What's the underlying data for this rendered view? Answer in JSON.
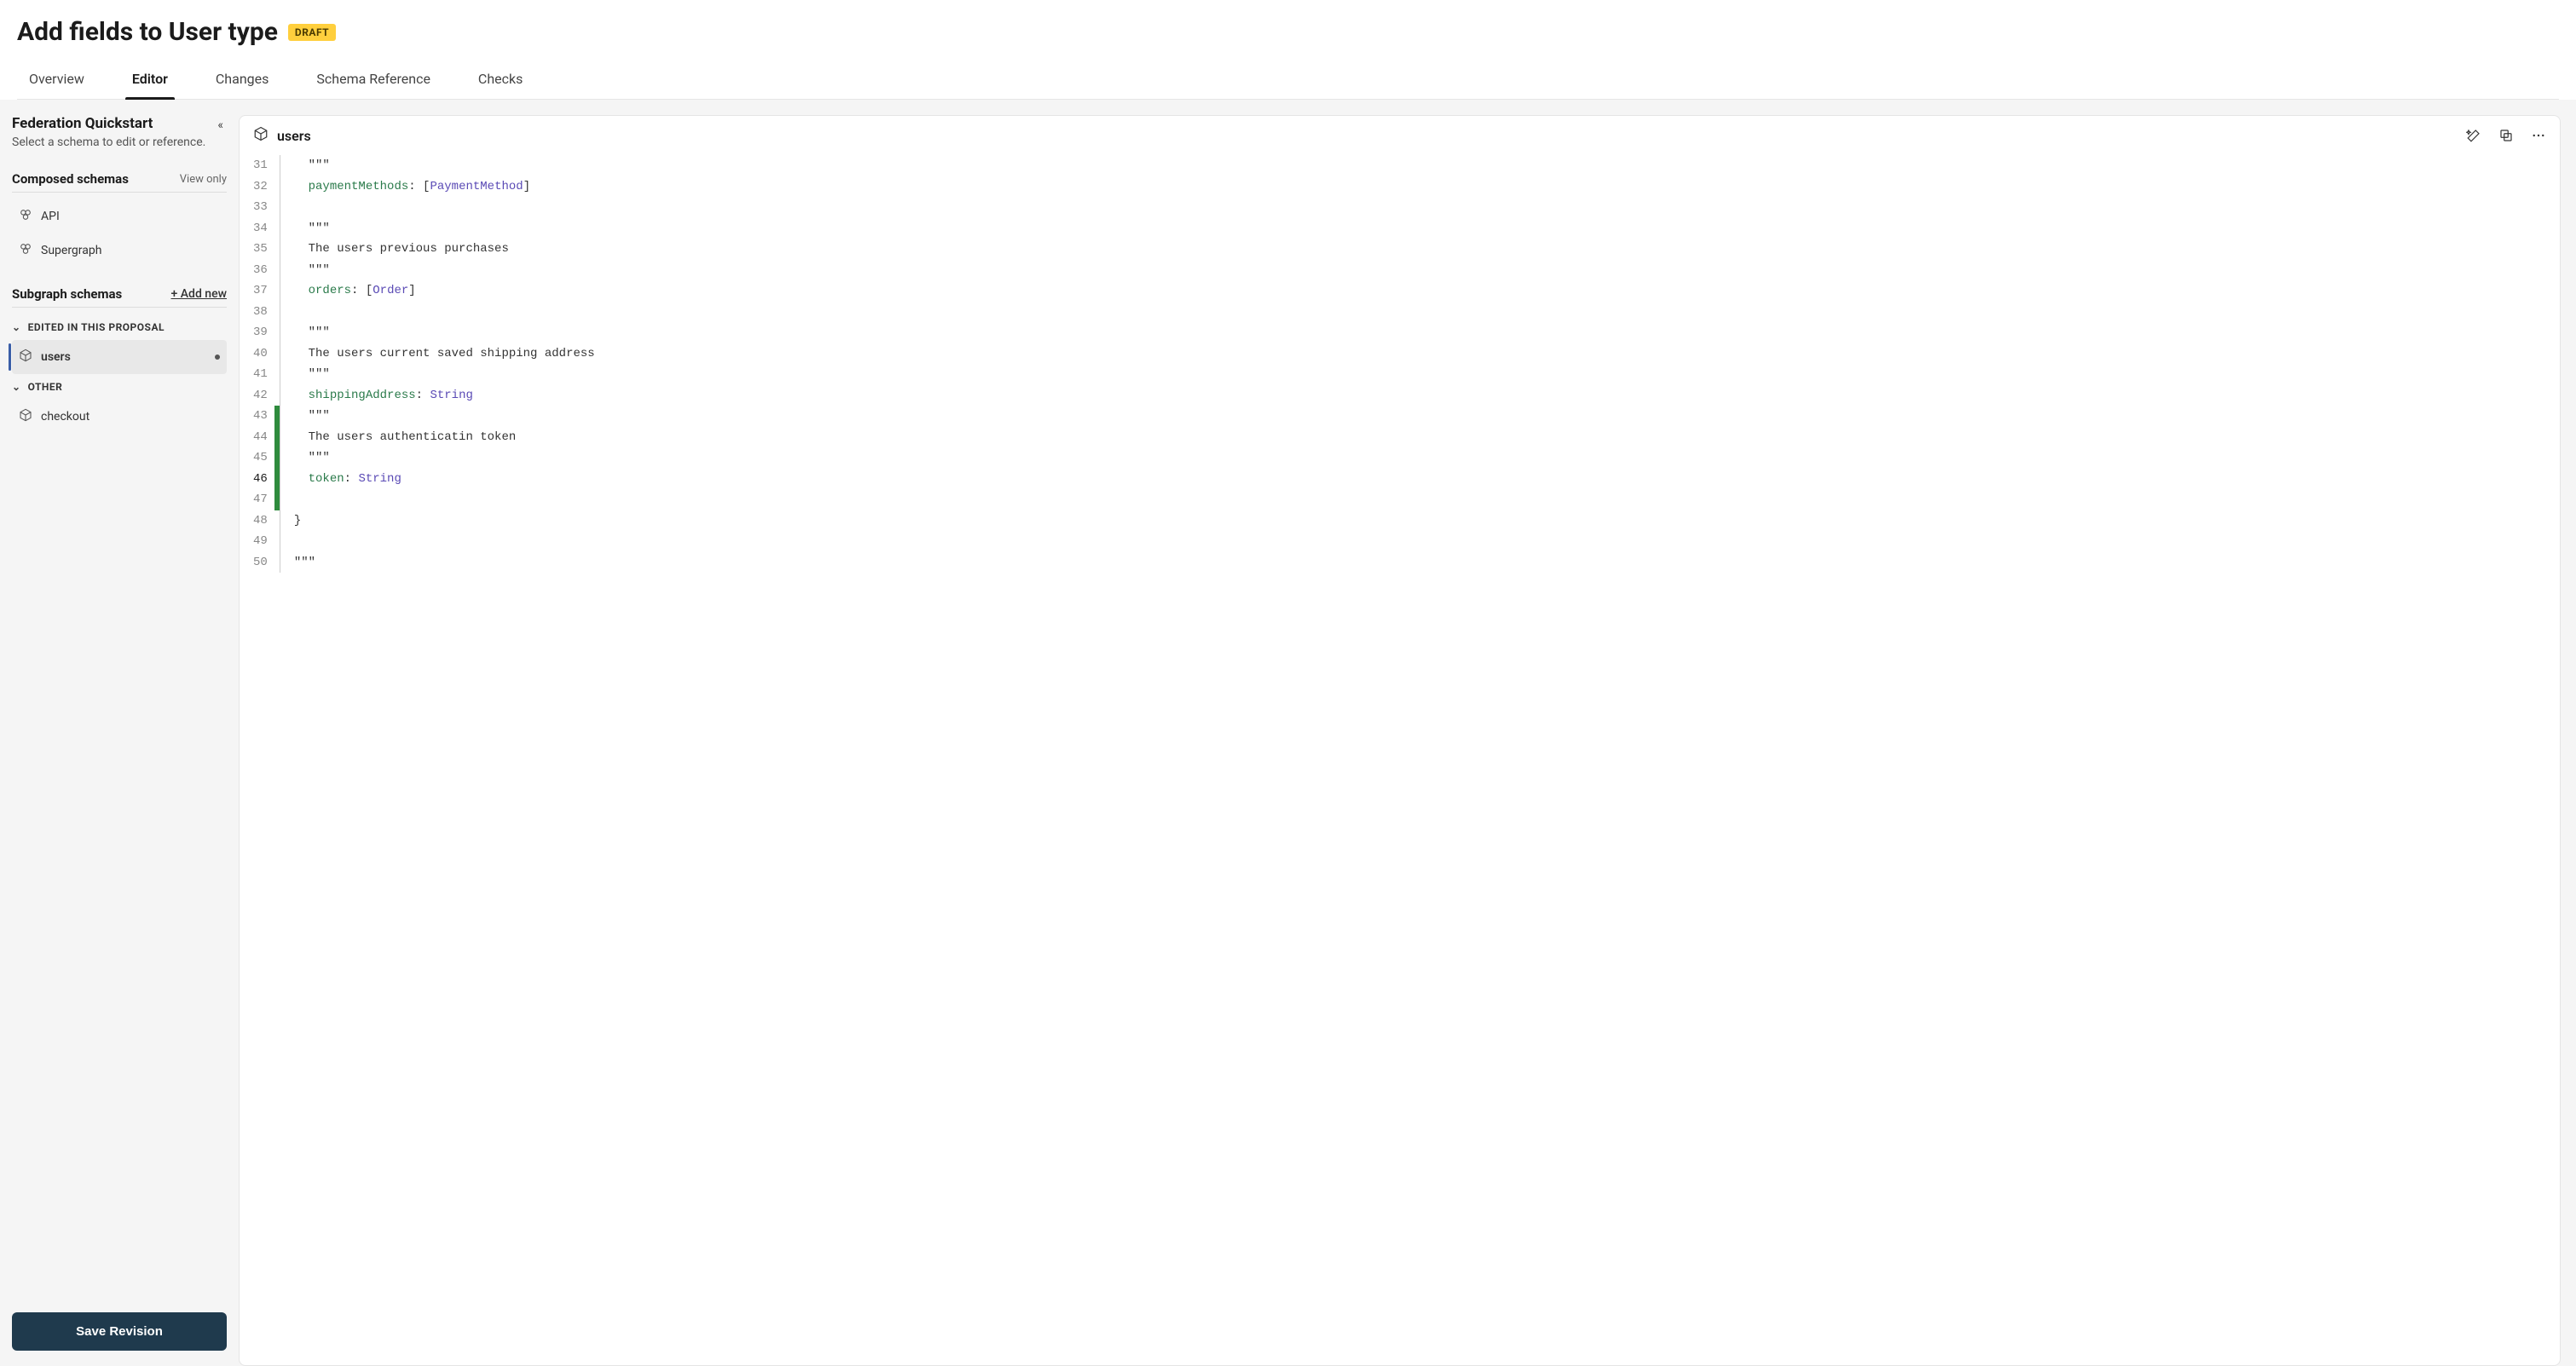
{
  "header": {
    "title": "Add fields to User type",
    "badge": "DRAFT"
  },
  "tabs": [
    {
      "label": "Overview",
      "active": false
    },
    {
      "label": "Editor",
      "active": true
    },
    {
      "label": "Changes",
      "active": false
    },
    {
      "label": "Schema Reference",
      "active": false
    },
    {
      "label": "Checks",
      "active": false
    }
  ],
  "sidebar": {
    "title": "Federation Quickstart",
    "subtitle": "Select a schema to edit or reference.",
    "composed": {
      "title": "Composed schemas",
      "badge": "View only",
      "items": [
        {
          "label": "API",
          "icon": "composed"
        },
        {
          "label": "Supergraph",
          "icon": "composed"
        }
      ]
    },
    "subgraph": {
      "title": "Subgraph schemas",
      "addLabel": "+ Add new",
      "groups": [
        {
          "label": "EDITED IN THIS PROPOSAL",
          "items": [
            {
              "label": "users",
              "active": true,
              "modified": true
            }
          ]
        },
        {
          "label": "OTHER",
          "items": [
            {
              "label": "checkout",
              "active": false,
              "modified": false
            }
          ]
        }
      ]
    },
    "saveLabel": "Save Revision"
  },
  "editor": {
    "filename": "users",
    "startLine": 31,
    "currentLine": 46,
    "lines": [
      {
        "n": 31,
        "added": false,
        "tokens": [
          [
            "doc",
            "  \"\"\""
          ]
        ]
      },
      {
        "n": 32,
        "added": false,
        "tokens": [
          [
            "plain",
            "  "
          ],
          [
            "field",
            "paymentMethods"
          ],
          [
            "punc",
            ": ["
          ],
          [
            "type",
            "PaymentMethod"
          ],
          [
            "punc",
            "]"
          ]
        ]
      },
      {
        "n": 33,
        "added": false,
        "tokens": []
      },
      {
        "n": 34,
        "added": false,
        "tokens": [
          [
            "doc",
            "  \"\"\""
          ]
        ]
      },
      {
        "n": 35,
        "added": false,
        "tokens": [
          [
            "plain",
            "  The users previous purchases"
          ]
        ]
      },
      {
        "n": 36,
        "added": false,
        "tokens": [
          [
            "doc",
            "  \"\"\""
          ]
        ]
      },
      {
        "n": 37,
        "added": false,
        "tokens": [
          [
            "plain",
            "  "
          ],
          [
            "field",
            "orders"
          ],
          [
            "punc",
            ": ["
          ],
          [
            "type",
            "Order"
          ],
          [
            "punc",
            "]"
          ]
        ]
      },
      {
        "n": 38,
        "added": false,
        "tokens": []
      },
      {
        "n": 39,
        "added": false,
        "tokens": [
          [
            "doc",
            "  \"\"\""
          ]
        ]
      },
      {
        "n": 40,
        "added": false,
        "tokens": [
          [
            "plain",
            "  The users current saved shipping address"
          ]
        ]
      },
      {
        "n": 41,
        "added": false,
        "tokens": [
          [
            "doc",
            "  \"\"\""
          ]
        ]
      },
      {
        "n": 42,
        "added": false,
        "tokens": [
          [
            "plain",
            "  "
          ],
          [
            "field",
            "shippingAddress"
          ],
          [
            "punc",
            ": "
          ],
          [
            "type",
            "String"
          ]
        ]
      },
      {
        "n": 43,
        "added": true,
        "tokens": [
          [
            "doc",
            "  \"\"\""
          ]
        ]
      },
      {
        "n": 44,
        "added": true,
        "tokens": [
          [
            "plain",
            "  The users authenticatin token"
          ]
        ]
      },
      {
        "n": 45,
        "added": true,
        "tokens": [
          [
            "doc",
            "  \"\"\""
          ]
        ]
      },
      {
        "n": 46,
        "added": true,
        "tokens": [
          [
            "plain",
            "  "
          ],
          [
            "field",
            "token"
          ],
          [
            "punc",
            ": "
          ],
          [
            "type",
            "String"
          ]
        ]
      },
      {
        "n": 47,
        "added": true,
        "tokens": []
      },
      {
        "n": 48,
        "added": false,
        "tokens": [
          [
            "punc",
            "}"
          ]
        ]
      },
      {
        "n": 49,
        "added": false,
        "tokens": []
      },
      {
        "n": 50,
        "added": false,
        "tokens": [
          [
            "doc",
            "\"\"\""
          ]
        ]
      }
    ]
  }
}
